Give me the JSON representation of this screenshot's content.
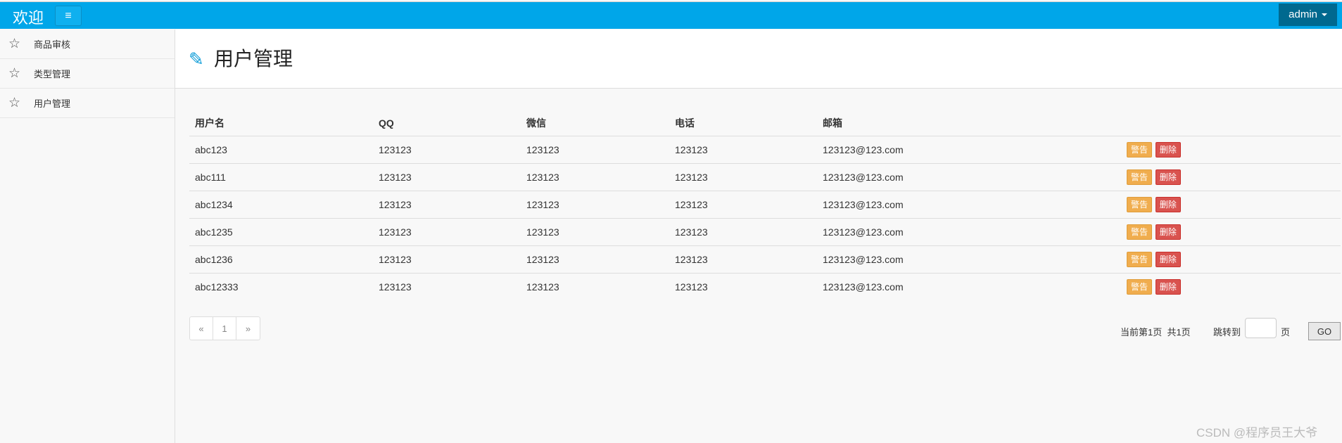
{
  "header": {
    "brand": "欢迎",
    "user": "admin"
  },
  "sidebar": {
    "items": [
      {
        "label": "商品审核"
      },
      {
        "label": "类型管理"
      },
      {
        "label": "用户管理"
      }
    ]
  },
  "main": {
    "title": "用户管理",
    "table": {
      "headers": [
        "用户名",
        "QQ",
        "微信",
        "电话",
        "邮箱"
      ],
      "rows": [
        {
          "username": "abc123",
          "qq": "123123",
          "wechat": "123123",
          "phone": "123123",
          "email": "123123@123.com"
        },
        {
          "username": "abc111",
          "qq": "123123",
          "wechat": "123123",
          "phone": "123123",
          "email": "123123@123.com"
        },
        {
          "username": "abc1234",
          "qq": "123123",
          "wechat": "123123",
          "phone": "123123",
          "email": "123123@123.com"
        },
        {
          "username": "abc1235",
          "qq": "123123",
          "wechat": "123123",
          "phone": "123123",
          "email": "123123@123.com"
        },
        {
          "username": "abc1236",
          "qq": "123123",
          "wechat": "123123",
          "phone": "123123",
          "email": "123123@123.com"
        },
        {
          "username": "abc12333",
          "qq": "123123",
          "wechat": "123123",
          "phone": "123123",
          "email": "123123@123.com"
        }
      ],
      "action_warn": "警告",
      "action_delete": "删除"
    },
    "pagination": {
      "prev": "«",
      "current": "1",
      "next": "»"
    },
    "page_info": "当前第1页  共1页",
    "jump_label": "跳转到",
    "jump_unit": "页",
    "go_label": "GO"
  },
  "watermark": "CSDN @程序员王大爷",
  "colors": {
    "header": "#00a6e9",
    "warn": "#f0ad4e",
    "delete": "#d9534f"
  }
}
